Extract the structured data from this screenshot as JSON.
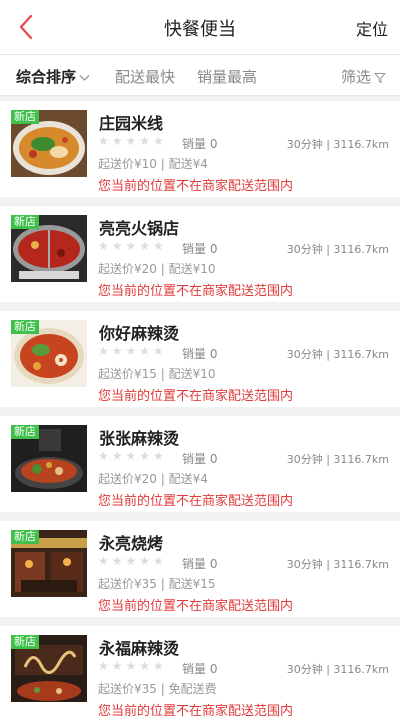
{
  "header": {
    "title": "快餐便当",
    "right_label": "定位",
    "back_icon": "chevron-left-icon",
    "accent_color": "#e8454a"
  },
  "filters": [
    {
      "label": "综合排序",
      "active": true
    },
    {
      "label": "配送最快",
      "active": false
    },
    {
      "label": "销量最高",
      "active": false
    },
    {
      "label": "筛选",
      "active": false
    }
  ],
  "restaurants": [
    {
      "tag": "新店",
      "name": "庄园米线",
      "sales": "销量 0",
      "distance": "30分钟 | 3116.7km",
      "fee": "起送价¥10 | 配送¥4",
      "notice": "您当前的位置不在商家配送范围内",
      "rating": 0,
      "image": "rice-noodle-photo"
    },
    {
      "tag": "新店",
      "name": "亮亮火锅店",
      "sales": "销量 0",
      "distance": "30分钟 | 3116.7km",
      "fee": "起送价¥20 | 配送¥10",
      "notice": "您当前的位置不在商家配送范围内",
      "rating": 0,
      "image": "hotpot-photo"
    },
    {
      "tag": "新店",
      "name": "你好麻辣烫",
      "sales": "销量 0",
      "distance": "30分钟 | 3116.7km",
      "fee": "起送价¥15 | 配送¥10",
      "notice": "您当前的位置不在商家配送范围内",
      "rating": 0,
      "image": "malatang-bowl-photo"
    },
    {
      "tag": "新店",
      "name": "张张麻辣烫",
      "sales": "销量 0",
      "distance": "30分钟 | 3116.7km",
      "fee": "起送价¥20 | 配送¥4",
      "notice": "您当前的位置不在商家配送范围内",
      "rating": 0,
      "image": "malatang-pot-photo"
    },
    {
      "tag": "新店",
      "name": "永亮烧烤",
      "sales": "销量 0",
      "distance": "30分钟 | 3116.7km",
      "fee": "起送价¥35 | 配送¥15",
      "notice": "您当前的位置不在商家配送范围内",
      "rating": 0,
      "image": "bbq-storefront-photo"
    },
    {
      "tag": "新店",
      "name": "永福麻辣烫",
      "sales": "销量 0",
      "distance": "30分钟 | 3116.7km",
      "fee": "起送价¥35 | 免配送费",
      "notice": "您当前的位置不在商家配送范围内",
      "rating": 0,
      "image": "malatang-sign-photo"
    }
  ]
}
